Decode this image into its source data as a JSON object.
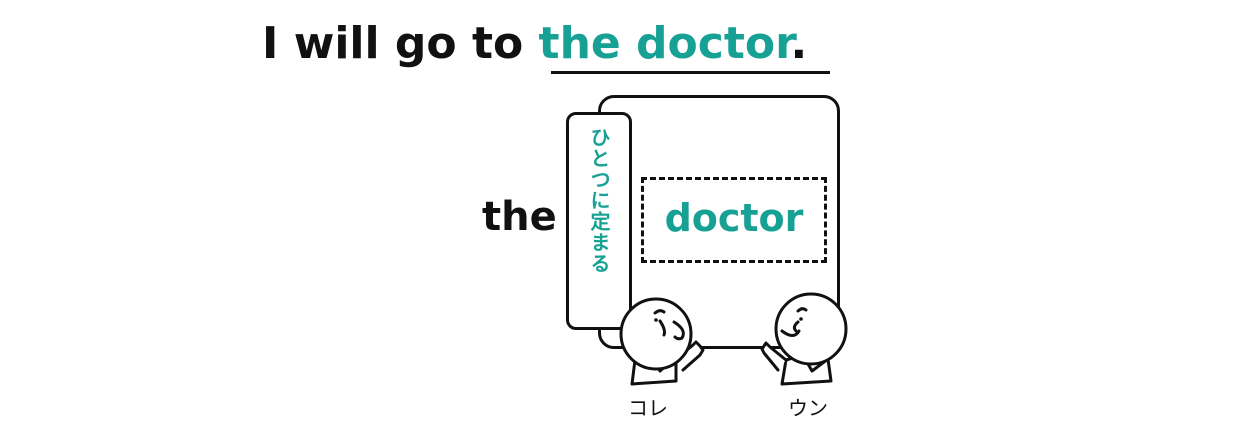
{
  "sentence": {
    "before": "I will go to ",
    "highlight": "the doctor",
    "after": "."
  },
  "diagram": {
    "article": "the",
    "tag_text": "ひとつに定まる",
    "noun": "doctor",
    "left_character_caption": "コレ",
    "right_character_caption": "ウン"
  },
  "colors": {
    "accent": "#17a194",
    "ink": "#111111",
    "background": "#ffffff"
  }
}
